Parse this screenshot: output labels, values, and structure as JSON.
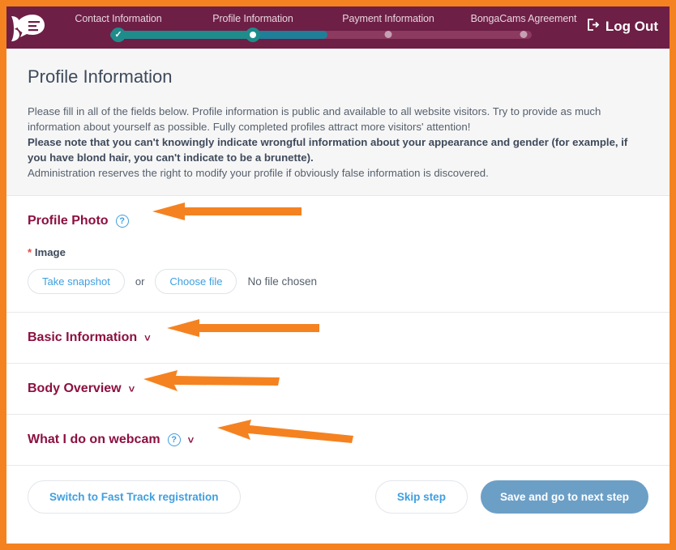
{
  "branding": {
    "logo_name": "bongacams-logo",
    "header_bg": "#6e1f46",
    "accent_orange": "#f58220",
    "accent_blue": "#3f9fe0",
    "heading_maroon": "#8c1040",
    "primary_button_blue": "#6c9fc6",
    "teal": "#1f8c8c"
  },
  "header": {
    "logout_label": "Log Out",
    "steps": [
      {
        "label": "Contact Information",
        "state": "done"
      },
      {
        "label": "Profile Information",
        "state": "current"
      },
      {
        "label": "Payment Information",
        "state": "todo"
      },
      {
        "label": "BongaCams Agreement",
        "state": "todo"
      }
    ]
  },
  "intro": {
    "title": "Profile Information",
    "paragraph1": "Please fill in all of the fields below. Profile information is public and available to all website visitors. Try to provide as much information about yourself as possible. Fully completed profiles attract more visitors' attention!",
    "paragraph2": "Please note that you can't knowingly indicate wrongful information about your appearance and gender (for example, if you have blond hair, you can't indicate to be a brunette).",
    "paragraph3": "Administration reserves the right to modify your profile if obviously false information is discovered."
  },
  "profile_photo": {
    "heading": "Profile Photo",
    "help_icon": "question-mark-icon",
    "field_label_star": "*",
    "field_label": "Image",
    "take_snapshot_label": "Take snapshot",
    "or_label": "or",
    "choose_file_label": "Choose file",
    "file_status": "No file chosen"
  },
  "sections": [
    {
      "heading": "Basic Information",
      "has_help": false,
      "chevron": "⌄"
    },
    {
      "heading": "Body Overview",
      "has_help": false,
      "chevron": "⌄"
    },
    {
      "heading": "What I do on webcam",
      "has_help": true,
      "chevron": "⌄"
    }
  ],
  "chevron_glyph": "ˇ",
  "footer": {
    "fast_track_label": "Switch to Fast Track registration",
    "skip_label": "Skip step",
    "save_label": "Save and go to next step"
  }
}
